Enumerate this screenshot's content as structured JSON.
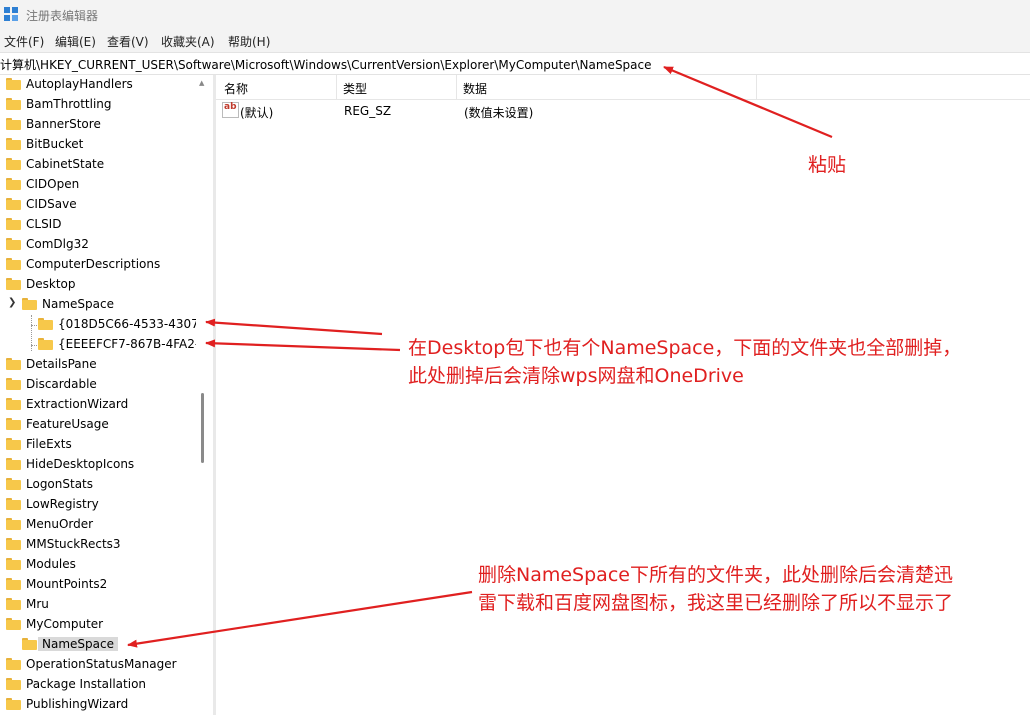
{
  "window": {
    "title": "注册表编辑器"
  },
  "menu": [
    {
      "label": "文件(F)"
    },
    {
      "label": "编辑(E)"
    },
    {
      "label": "查看(V)"
    },
    {
      "label": "收藏夹(A)"
    },
    {
      "label": "帮助(H)"
    }
  ],
  "address": {
    "path": "计算机\\HKEY_CURRENT_USER\\Software\\Microsoft\\Windows\\CurrentVersion\\Explorer\\MyComputer\\NameSpace"
  },
  "tree": {
    "items": [
      {
        "label": "AutoplayHandlers"
      },
      {
        "label": "BamThrottling"
      },
      {
        "label": "BannerStore"
      },
      {
        "label": "BitBucket"
      },
      {
        "label": "CabinetState"
      },
      {
        "label": "CIDOpen"
      },
      {
        "label": "CIDSave"
      },
      {
        "label": "CLSID"
      },
      {
        "label": "ComDlg32"
      },
      {
        "label": "ComputerDescriptions"
      },
      {
        "label": "Desktop"
      },
      {
        "label": "NameSpace"
      },
      {
        "label": "{018D5C66-4533-4307-"
      },
      {
        "label": "{EEEEFCF7-867B-4FA2-9"
      },
      {
        "label": "DetailsPane"
      },
      {
        "label": "Discardable"
      },
      {
        "label": "ExtractionWizard"
      },
      {
        "label": "FeatureUsage"
      },
      {
        "label": "FileExts"
      },
      {
        "label": "HideDesktopIcons"
      },
      {
        "label": "LogonStats"
      },
      {
        "label": "LowRegistry"
      },
      {
        "label": "MenuOrder"
      },
      {
        "label": "MMStuckRects3"
      },
      {
        "label": "Modules"
      },
      {
        "label": "MountPoints2"
      },
      {
        "label": "Mru"
      },
      {
        "label": "MyComputer"
      },
      {
        "label": "NameSpace"
      },
      {
        "label": "OperationStatusManager"
      },
      {
        "label": "Package Installation"
      },
      {
        "label": "PublishingWizard"
      }
    ]
  },
  "list": {
    "headers": {
      "name": "名称",
      "type": "类型",
      "data": "数据"
    },
    "rows": [
      {
        "name": "(默认)",
        "type": "REG_SZ",
        "data": "(数值未设置)",
        "icon": "ab-string-icon"
      }
    ]
  },
  "annotations": {
    "paste": "粘贴",
    "desktop_line1": "在Desktop包下也有个NameSpace，下面的文件夹也全部删掉，",
    "desktop_line2": "此处删掉后会清除wps网盘和OneDrive",
    "mycomputer_line1": "删除NameSpace下所有的文件夹，此处删除后会清楚迅",
    "mycomputer_line2": "雷下载和百度网盘图标，我这里已经删除了所以不显示了"
  },
  "colors": {
    "annotation": "#e02020",
    "folder": "#f7c84a",
    "selection": "#d9d9d9"
  }
}
